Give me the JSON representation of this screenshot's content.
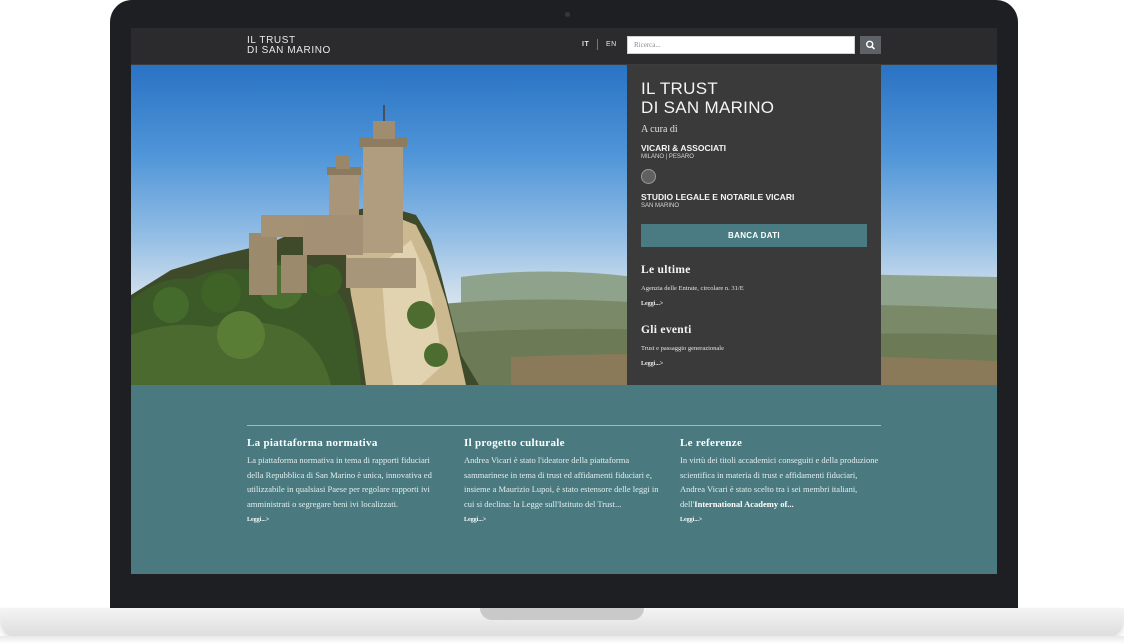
{
  "header": {
    "logo_line1": "IL TRUST",
    "logo_line2": "DI SAN MARINO",
    "lang_it": "IT",
    "lang_en": "EN",
    "search_placeholder": "Ricerca..."
  },
  "sidebar": {
    "title_line1": "IL TRUST",
    "title_line2": "DI SAN MARINO",
    "curated_by": "A cura di",
    "org1_name": "VICARI & ASSOCIATI",
    "org1_location": "MILANO | PESARO",
    "org2_name": "STUDIO LEGALE E NOTARILE VICARI",
    "org2_location": "SAN MARINO",
    "database_button": "BANCA DATI",
    "latest_heading": "Le ultime",
    "latest_item": "Agenzia delle Entrate, circolare n. 31/E",
    "latest_more": "Leggi...>",
    "events_heading": "Gli eventi",
    "events_item": "Trust e passaggio generazionale",
    "events_more": "Leggi...>"
  },
  "columns": [
    {
      "title": "La piattaforma normativa",
      "text": "La piattaforma normativa in tema di rapporti fiduciari della Repubblica di San Marino è unica, innovativa ed utilizzabile in qualsiasi Paese per regolare rapporti ivi amministrati o segregare beni ivi localizzati.",
      "more": "Leggi...>"
    },
    {
      "title": "Il progetto culturale",
      "text": "Andrea Vicari è stato l'ideatore della piattaforma sammarinese in tema di trust ed affidamenti fiduciari e, insieme a Maurizio Lupoi, è stato estensore delle leggi in cui si declina: la Legge sull'Istituto del Trust...",
      "more": "Leggi...>"
    },
    {
      "title": "Le referenze",
      "text": "In virtù dei titoli accademici conseguiti e della produzione scientifica in materia di trust e affidamenti fiduciari, Andrea Vicari è stato scelto tra i sei membri italiani, dell'",
      "text_bold": "International Academy of...",
      "more": "Leggi...>"
    }
  ],
  "colors": {
    "topbar": "#2b2b2d",
    "panel": "#3a3a3a",
    "teal": "#4a7a80",
    "button": "#4a7b82",
    "frame": "#1e1f22"
  },
  "icons": {
    "search": "search-icon",
    "org_emblem": "emblem-icon"
  }
}
